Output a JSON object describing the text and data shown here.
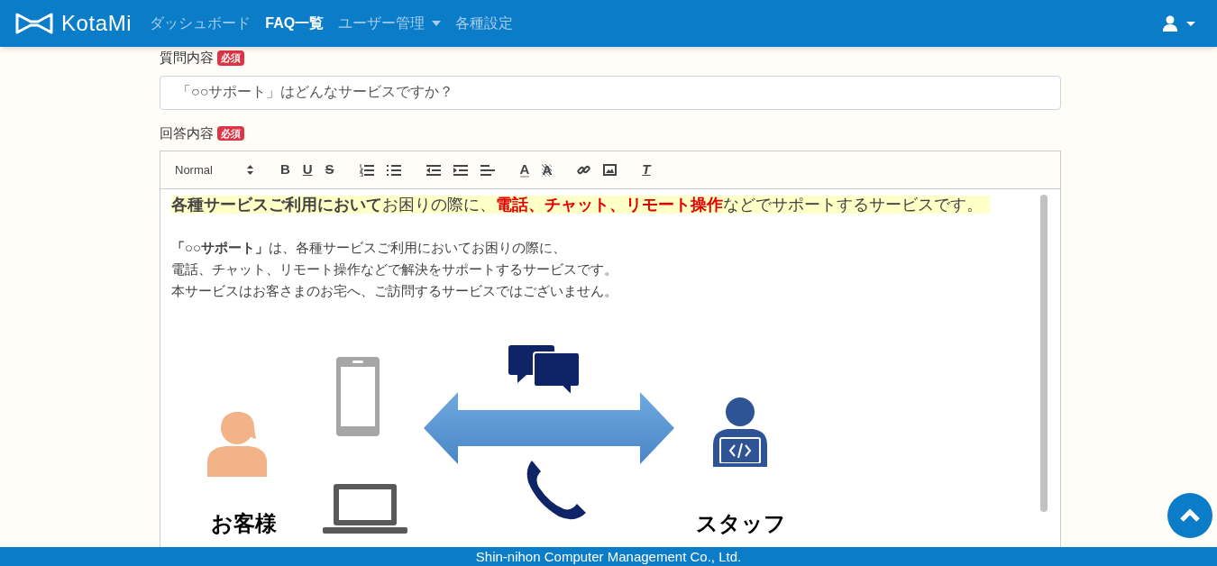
{
  "navbar": {
    "brand": "KotaMi",
    "items": [
      {
        "label": "ダッシュボード",
        "selected": false,
        "dropdown": false
      },
      {
        "label": "FAQ一覧",
        "selected": true,
        "dropdown": false
      },
      {
        "label": "ユーザー管理",
        "selected": false,
        "dropdown": true
      },
      {
        "label": "各種設定",
        "selected": false,
        "dropdown": false
      }
    ]
  },
  "question": {
    "label": "質問内容",
    "required_badge": "必須",
    "value": "「○○サポート」はどんなサービスですか？"
  },
  "answer": {
    "label": "回答内容",
    "required_badge": "必須",
    "toolbar": [
      {
        "kind": "select",
        "label": "Normal"
      },
      {
        "kind": "bold",
        "label": "B"
      },
      {
        "kind": "underline",
        "label": "U"
      },
      {
        "kind": "strike",
        "label": "S"
      },
      {
        "kind": "ordered-list"
      },
      {
        "kind": "bullet-list"
      },
      {
        "kind": "outdent"
      },
      {
        "kind": "indent"
      },
      {
        "kind": "align"
      },
      {
        "kind": "color",
        "label": "A"
      },
      {
        "kind": "background",
        "label": "A"
      },
      {
        "kind": "link"
      },
      {
        "kind": "image"
      },
      {
        "kind": "clean",
        "label": "T"
      }
    ],
    "lead": [
      {
        "kind": "bold",
        "text": "各種サービスご利用において"
      },
      {
        "kind": "plain",
        "text": "お困りの際に、"
      },
      {
        "kind": "red",
        "text": "電話、チャット、リモート操作"
      },
      {
        "kind": "plain",
        "text": "などでサポートするサービスです。"
      }
    ],
    "lines": [
      "**「○○サポート」**は、各種サービスご利用においてお困りの際に、",
      "電話、チャット、リモート操作などで解決をサポートするサービスです。",
      "本サービスはお客さまのお宅へ、ご訪問するサービスではございません。"
    ],
    "diagram": {
      "customer_label": "お客様",
      "staff_label": "スタッフ"
    }
  },
  "footer": "Shin-nihon Computer Management Co., Ltd."
}
